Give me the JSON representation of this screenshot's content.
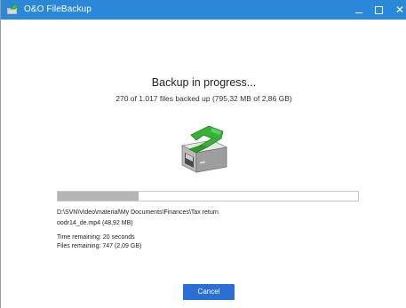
{
  "window": {
    "title": "O&O FileBackup",
    "controls": {
      "minimize": "_",
      "maximize": "□",
      "close": "✕"
    },
    "titlebar_color": "#2b88d8"
  },
  "main": {
    "heading": "Backup in progress...",
    "summary": "270 of 1.017 files backed up (795,32 MB of 2,86 GB)",
    "illustration_icon": "drive-with-green-arrow-icon",
    "progress": {
      "fraction": 0.27,
      "fill_color": "#b5b5b5"
    },
    "current_path": "D:\\SVN\\Video\\material\\My Documents\\Finances\\Tax return",
    "current_file": "oodr14_de.mp4 (48,92 MB)",
    "time_remaining": "Time remaining: 20 seconds",
    "files_remaining": "Files remaining: 747 (2,09 GB)"
  },
  "footer": {
    "cancel_label": "Cancel",
    "cancel_color": "#2b6fd6"
  }
}
